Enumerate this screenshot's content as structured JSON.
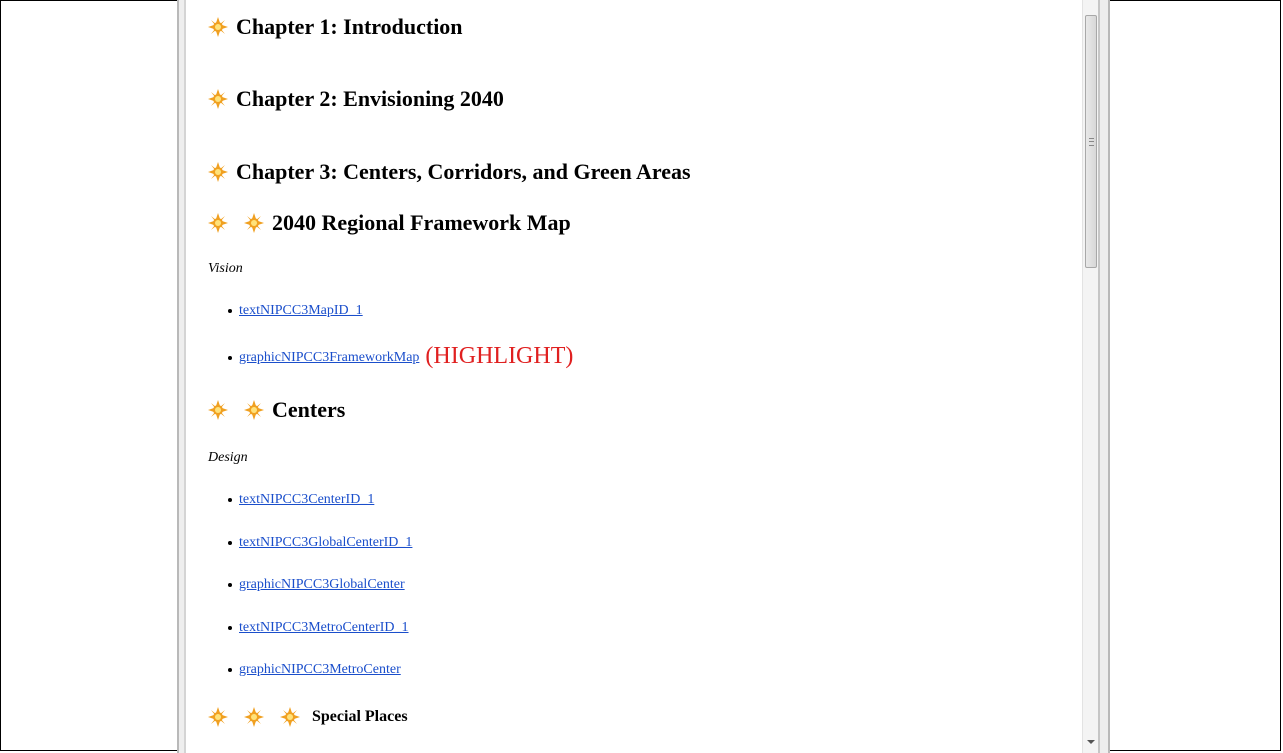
{
  "chapters": [
    {
      "title": "Chapter 1: Introduction"
    },
    {
      "title": "Chapter 2: Envisioning 2040"
    },
    {
      "title": "Chapter 3: Centers, Corridors, and Green Areas"
    }
  ],
  "sections": {
    "framework": {
      "title": "2040 Regional Framework Map",
      "label": "Vision",
      "links": [
        "textNIPCC3MapID_1",
        "graphicNIPCC3FrameworkMap"
      ],
      "highlight": "(HIGHLIGHT)"
    },
    "centers": {
      "title": "Centers",
      "label": "Design",
      "links": [
        "textNIPCC3CenterID_1",
        "textNIPCC3GlobalCenterID_1",
        "graphicNIPCC3GlobalCenter",
        "textNIPCC3MetroCenterID_1",
        "graphicNIPCC3MetroCenter"
      ]
    },
    "special_places": {
      "title": "Special Places"
    }
  },
  "colors": {
    "link": "#1a4ecb",
    "highlight": "#e02020",
    "sun_icon": "#f0a020"
  }
}
